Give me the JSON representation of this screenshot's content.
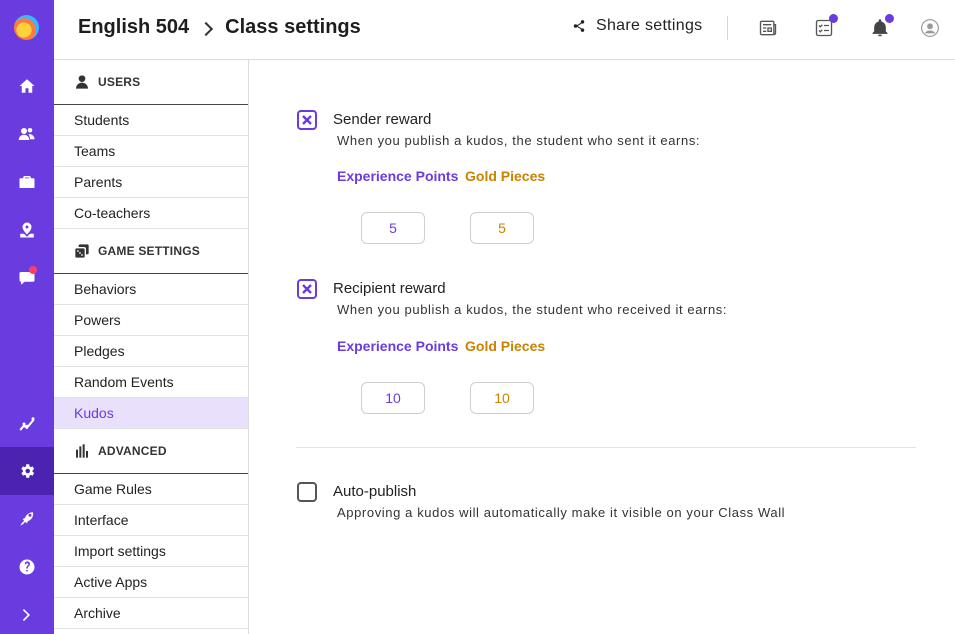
{
  "header": {
    "course": "English 504",
    "page": "Class settings",
    "share_label": "Share settings"
  },
  "sidebar": {
    "sections": [
      {
        "title": "USERS",
        "items": [
          "Students",
          "Teams",
          "Parents",
          "Co-teachers"
        ]
      },
      {
        "title": "GAME SETTINGS",
        "items": [
          "Behaviors",
          "Powers",
          "Pledges",
          "Random Events",
          "Kudos"
        ]
      },
      {
        "title": "ADVANCED",
        "items": [
          "Game Rules",
          "Interface",
          "Import settings",
          "Active Apps",
          "Archive"
        ]
      }
    ],
    "active_item": "Kudos"
  },
  "rail": {
    "icons": [
      "logo-icon",
      "home-icon",
      "users-icon",
      "briefcase-icon",
      "map-icon",
      "chat-icon",
      "chart-icon",
      "gear-icon",
      "rocket-icon",
      "help-icon",
      "chevron-right-icon"
    ],
    "active": "gear-icon"
  },
  "main": {
    "sender": {
      "title": "Sender reward",
      "desc": "When you publish a kudos, the student who sent it earns:",
      "checked": true,
      "xp_label": "Experience Points",
      "gp_label": "Gold Pieces",
      "xp_value": "5",
      "gp_value": "5"
    },
    "recipient": {
      "title": "Recipient reward",
      "desc": "When you publish a kudos, the student who received it earns:",
      "checked": true,
      "xp_label": "Experience Points",
      "gp_label": "Gold Pieces",
      "xp_value": "10",
      "gp_value": "10"
    },
    "autopublish": {
      "title": "Auto-publish",
      "desc": "Approving a kudos will automatically make it visible on your Class Wall",
      "checked": false
    }
  },
  "colors": {
    "accent": "#6a3ce0",
    "accent_dark": "#4b23b0",
    "gold": "#c98300",
    "notification": "#ff3b6b"
  }
}
